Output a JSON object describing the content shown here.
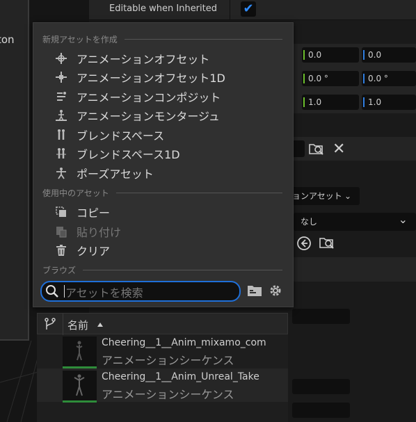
{
  "viewport": {
    "partial_label": "ton"
  },
  "details": {
    "editable_when_inherited": {
      "label": "Editable when Inherited",
      "checked": true
    },
    "location_row": {
      "y": "0.0",
      "z": "0.0"
    },
    "rotation_row": {
      "y": "0.0 °",
      "z": "0.0 °"
    },
    "scale_row": {
      "y": "1.0",
      "z": "1.0"
    },
    "anim_mode_dropdown": "ョンアセット",
    "none_dropdown": "なし"
  },
  "menu": {
    "create_section": "新規アセットを作成",
    "create_items": [
      {
        "label": "アニメーションオフセット",
        "icon": "aim-offset-icon"
      },
      {
        "label": "アニメーションオフセット1D",
        "icon": "aim-offset-1d-icon"
      },
      {
        "label": "アニメーションコンポジット",
        "icon": "composite-icon"
      },
      {
        "label": "アニメーションモンタージュ",
        "icon": "montage-icon"
      },
      {
        "label": "ブレンドスペース",
        "icon": "blendspace-icon"
      },
      {
        "label": "ブレンドスペース1D",
        "icon": "blendspace-1d-icon"
      },
      {
        "label": "ポーズアセット",
        "icon": "pose-icon"
      }
    ],
    "current_section": "使用中のアセット",
    "current_items": [
      {
        "label": "コピー",
        "icon": "copy-icon",
        "enabled": true
      },
      {
        "label": "貼り付け",
        "icon": "paste-icon",
        "enabled": false
      },
      {
        "label": "クリア",
        "icon": "trash-icon",
        "enabled": true
      }
    ],
    "browse_section": "ブラウズ",
    "search_placeholder": "アセットを検索",
    "search_value": ""
  },
  "asset_list": {
    "column_name": "名前",
    "sort": "ascending",
    "rows": [
      {
        "name": "Cheering__1__Anim_mixamo_com",
        "type": "アニメーションシーケンス"
      },
      {
        "name": "Cheering__1__Anim_Unreal_Take",
        "type": "アニメーションシーケンス"
      }
    ]
  },
  "colors": {
    "accent_blue": "#1f6fd8",
    "check_blue": "#2f8cff",
    "axis_green": "#6bbf2b",
    "axis_blue": "#2f7de0",
    "asset_green": "#2e8c3a"
  }
}
